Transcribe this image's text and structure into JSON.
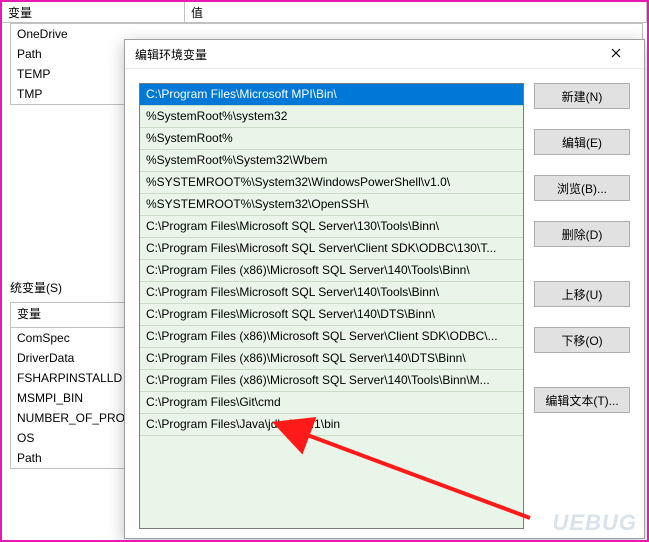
{
  "bg": {
    "header_variable": "变量",
    "header_value": "值",
    "user_vars": [
      "OneDrive",
      "Path",
      "TEMP",
      "TMP"
    ],
    "sys_label": "统变量(S)",
    "sys_vars_header": "变量",
    "sys_vars": [
      "ComSpec",
      "DriverData",
      "FSHARPINSTALLD",
      "MSMPI_BIN",
      "NUMBER_OF_PRO",
      "OS",
      "Path"
    ]
  },
  "dialog": {
    "title": "编辑环境变量",
    "selected_index": 0,
    "paths": [
      "C:\\Program Files\\Microsoft MPI\\Bin\\",
      "%SystemRoot%\\system32",
      "%SystemRoot%",
      "%SystemRoot%\\System32\\Wbem",
      "%SYSTEMROOT%\\System32\\WindowsPowerShell\\v1.0\\",
      "%SYSTEMROOT%\\System32\\OpenSSH\\",
      "C:\\Program Files\\Microsoft SQL Server\\130\\Tools\\Binn\\",
      "C:\\Program Files\\Microsoft SQL Server\\Client SDK\\ODBC\\130\\T...",
      "C:\\Program Files (x86)\\Microsoft SQL Server\\140\\Tools\\Binn\\",
      "C:\\Program Files\\Microsoft SQL Server\\140\\Tools\\Binn\\",
      "C:\\Program Files\\Microsoft SQL Server\\140\\DTS\\Binn\\",
      "C:\\Program Files (x86)\\Microsoft SQL Server\\Client SDK\\ODBC\\...",
      "C:\\Program Files (x86)\\Microsoft SQL Server\\140\\DTS\\Binn\\",
      "C:\\Program Files (x86)\\Microsoft SQL Server\\140\\Tools\\Binn\\M...",
      "C:\\Program Files\\Git\\cmd",
      "C:\\Program Files\\Java\\jdk-12.0.1\\bin"
    ],
    "buttons": {
      "new": "新建(N)",
      "edit": "编辑(E)",
      "browse": "浏览(B)...",
      "delete": "删除(D)",
      "moveup": "上移(U)",
      "movedown": "下移(O)",
      "edittext": "编辑文本(T)..."
    }
  },
  "watermark": "UEBUG"
}
